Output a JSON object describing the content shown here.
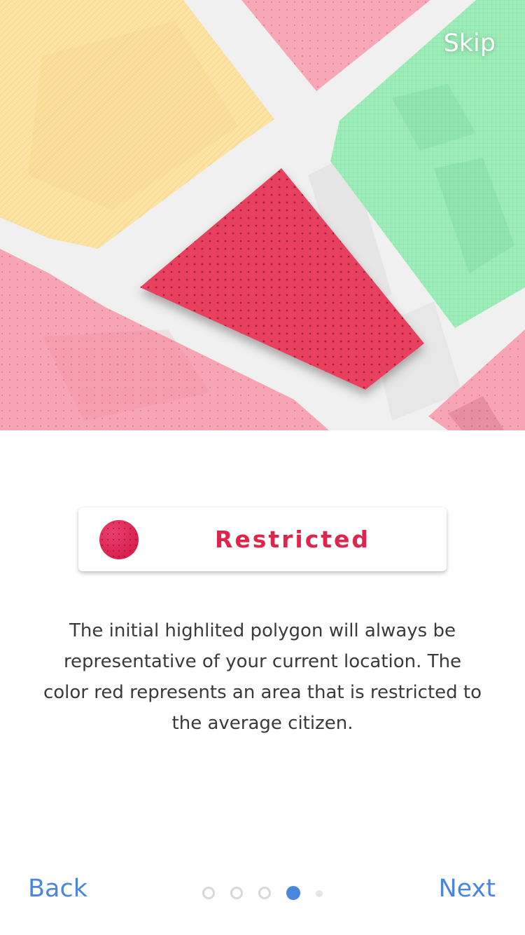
{
  "header": {
    "skip_label": "Skip"
  },
  "legend": {
    "label": "Restricted",
    "color": "#e0254c"
  },
  "description": {
    "text": "The initial highlited polygon will always be representative of your current location. The color red represents an area that is restricted to the average citizen."
  },
  "footer": {
    "back_label": "Back",
    "next_label": "Next",
    "page_indicator": {
      "total": 5,
      "current": 4
    }
  },
  "colors": {
    "accent": "#4a86e0",
    "restricted_red": "#e0254c",
    "zone_yellow": "#fde3a3",
    "zone_green": "#9eedb8",
    "zone_pink": "#f7a5b4"
  }
}
